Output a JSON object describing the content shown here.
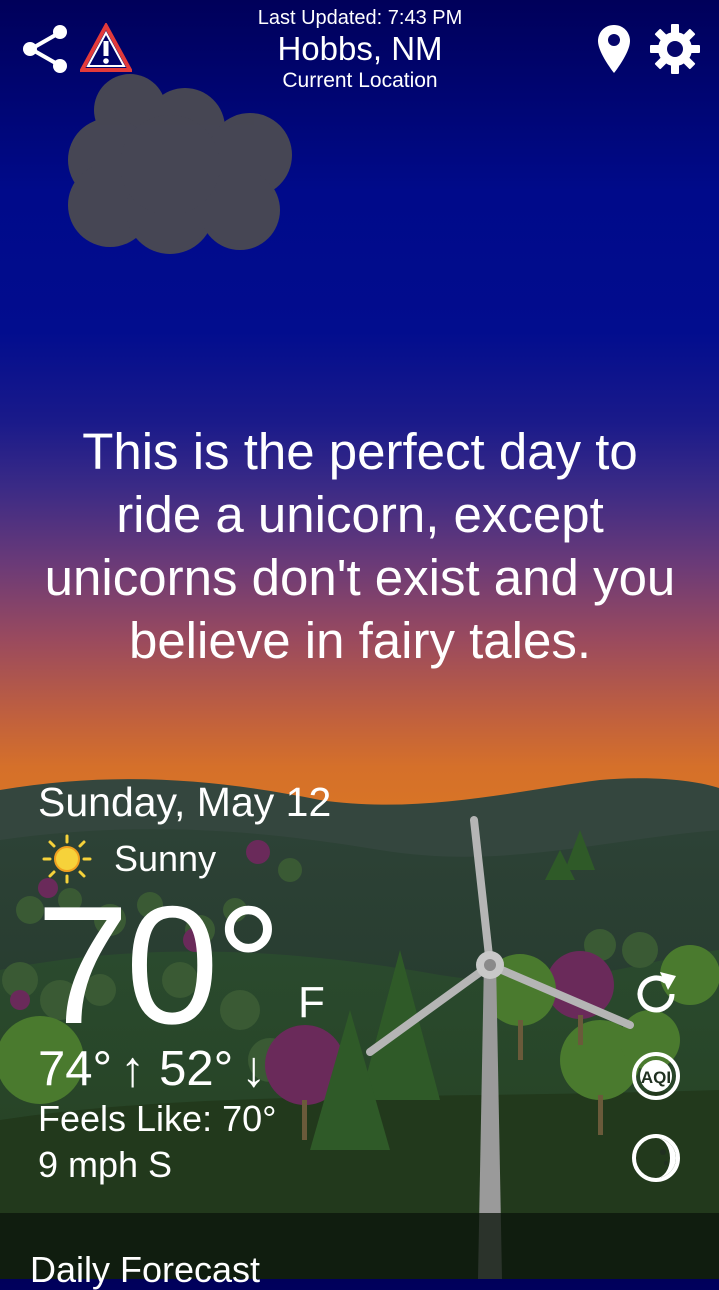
{
  "header": {
    "last_updated": "Last Updated: 7:43 PM",
    "location": "Hobbs, NM",
    "location_sub": "Current Location",
    "icons": {
      "share": "share-icon",
      "alert": "warning-icon",
      "location": "map-pin-icon",
      "settings": "gear-icon"
    }
  },
  "message": "This is the perfect day to ride a unicorn, except unicorns don't exist and you believe in fairy tales.",
  "weather": {
    "date": "Sunday, May 12",
    "condition": "Sunny",
    "condition_icon": "sun-icon",
    "temperature": "70°",
    "unit": "F",
    "high": "74°",
    "low": "52°",
    "feels_like": "Feels Like: 70°",
    "wind": "9 mph S"
  },
  "actions": {
    "refresh_icon": "refresh-icon",
    "aqi_label": "AQI",
    "moon_icon": "moon-phase-icon"
  },
  "footer": {
    "section_label": "Daily Forecast"
  },
  "colors": {
    "sky_top": "#00005a",
    "sky_mid": "#020d8e",
    "sunset": "#d87426",
    "hills": "#1f3a2a"
  }
}
